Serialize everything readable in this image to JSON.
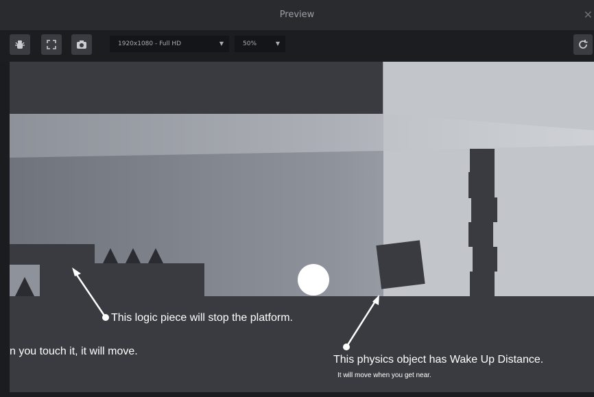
{
  "window": {
    "title": "Preview"
  },
  "toolbar": {
    "resolution": "1920x1080 - Full HD",
    "zoom": "50%"
  },
  "icons": {
    "debug": "bug-icon",
    "fullscreen": "fullscreen-icon",
    "screenshot": "camera-icon",
    "reload": "refresh-icon",
    "close": "close-icon"
  },
  "annotations": {
    "logic_piece": "This logic piece will stop the platform.",
    "touch_move": "n you touch it, it will move.",
    "physics_object": "This physics object has Wake Up Distance.",
    "physics_hint": "It will move when you get near."
  },
  "colors": {
    "floor": "#3a3b41",
    "ceiling": "#3a3b41",
    "sky_light": "#c4c7cc",
    "accent_white": "#ffffff"
  }
}
